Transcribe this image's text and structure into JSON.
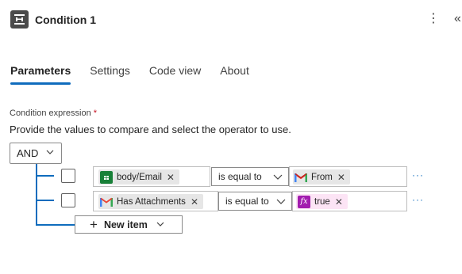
{
  "header": {
    "title": "Condition 1",
    "icon": "condition-icon",
    "more_label": "⋮",
    "collapse_label": "«"
  },
  "tabs": [
    {
      "label": "Parameters",
      "active": true
    },
    {
      "label": "Settings",
      "active": false
    },
    {
      "label": "Code view",
      "active": false
    },
    {
      "label": "About",
      "active": false
    }
  ],
  "condition": {
    "label": "Condition expression",
    "required_mark": "*",
    "description": "Provide the values to compare and select the operator to use.",
    "group_operator": "AND",
    "rows": [
      {
        "left": {
          "label": "body/Email",
          "icon": "sheets-icon"
        },
        "operator": "is equal to",
        "right": {
          "label": "From",
          "icon": "gmail-icon"
        },
        "more": "···"
      },
      {
        "left": {
          "label": "Has Attachments",
          "icon": "gmail-icon"
        },
        "operator": "is equal to",
        "right": {
          "label": "true",
          "icon": "expression-icon"
        },
        "more": "···"
      }
    ],
    "new_item_label": "New item"
  },
  "colors": {
    "accent": "#0f6cbd",
    "expression_token": "#fce4f5",
    "expression_icon": "#a21caf",
    "sheets": "#188038"
  }
}
